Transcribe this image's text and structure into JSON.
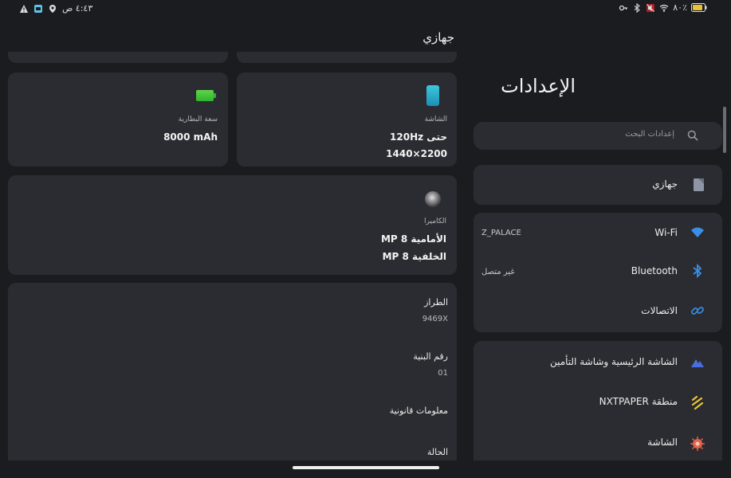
{
  "status_bar": {
    "time": "٤:٤٣ ص",
    "battery_text": "٨٠٪"
  },
  "detail": {
    "title": "جهازي",
    "battery_card": {
      "label": "سعة البطارية",
      "value": "8000 mAh"
    },
    "screen_card": {
      "label": "الشاشة",
      "line1": "حتى 120Hz",
      "line2": "1440×2200"
    },
    "camera_card": {
      "label": "الكاميرا",
      "front": "الأمامية  MP 8",
      "back": "الخلفية  MP 8"
    },
    "info_list": [
      {
        "label": "الطراز",
        "value": "9469X"
      },
      {
        "label": "رقم البنية",
        "value": "01"
      },
      {
        "label": "معلومات قانونية",
        "value": ""
      },
      {
        "label": "الحالة",
        "value": ""
      }
    ]
  },
  "settings": {
    "title": "الإعدادات",
    "search_placeholder": "إعدادات البحث",
    "my_device": "جهازي",
    "connections": [
      {
        "label": "Wi-Fi",
        "value": "Z_PALACE",
        "icon": "wifi-icon"
      },
      {
        "label": "Bluetooth",
        "value": "غير متصل",
        "icon": "bluetooth-icon"
      },
      {
        "label": "الاتصالات",
        "value": "",
        "icon": "link-icon"
      }
    ],
    "display_group": [
      {
        "label": "الشاشة الرئيسية وشاشة التأمين",
        "icon": "home-screen-icon"
      },
      {
        "label": "منطقة NXTPAPER",
        "icon": "nxtpaper-icon"
      },
      {
        "label": "الشاشة",
        "icon": "display-icon"
      }
    ]
  },
  "colors": {
    "background": "#1b1c20",
    "card": "#2b2c31",
    "accent_blue": "#3a8ee6",
    "battery_green": "#4cc83a"
  }
}
